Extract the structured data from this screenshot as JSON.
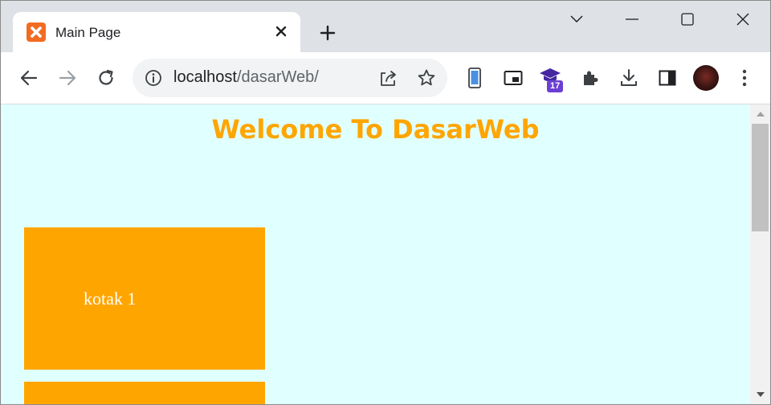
{
  "browser": {
    "tab": {
      "title": "Main Page",
      "favicon": "xampp-icon",
      "close_glyph": "✕"
    },
    "new_tab_glyph": "+",
    "url_host": "localhost",
    "url_path": "/dasarWeb/",
    "extension_badge": "17",
    "accent": "#6b3fd3"
  },
  "page": {
    "title": "Welcome To DasarWeb",
    "title_color": "#ffa500",
    "background": "#e0ffff",
    "boxes": [
      {
        "label": "kotak 1",
        "color": "#ffa500"
      },
      {
        "label": "",
        "color": "#ffa500"
      }
    ]
  }
}
